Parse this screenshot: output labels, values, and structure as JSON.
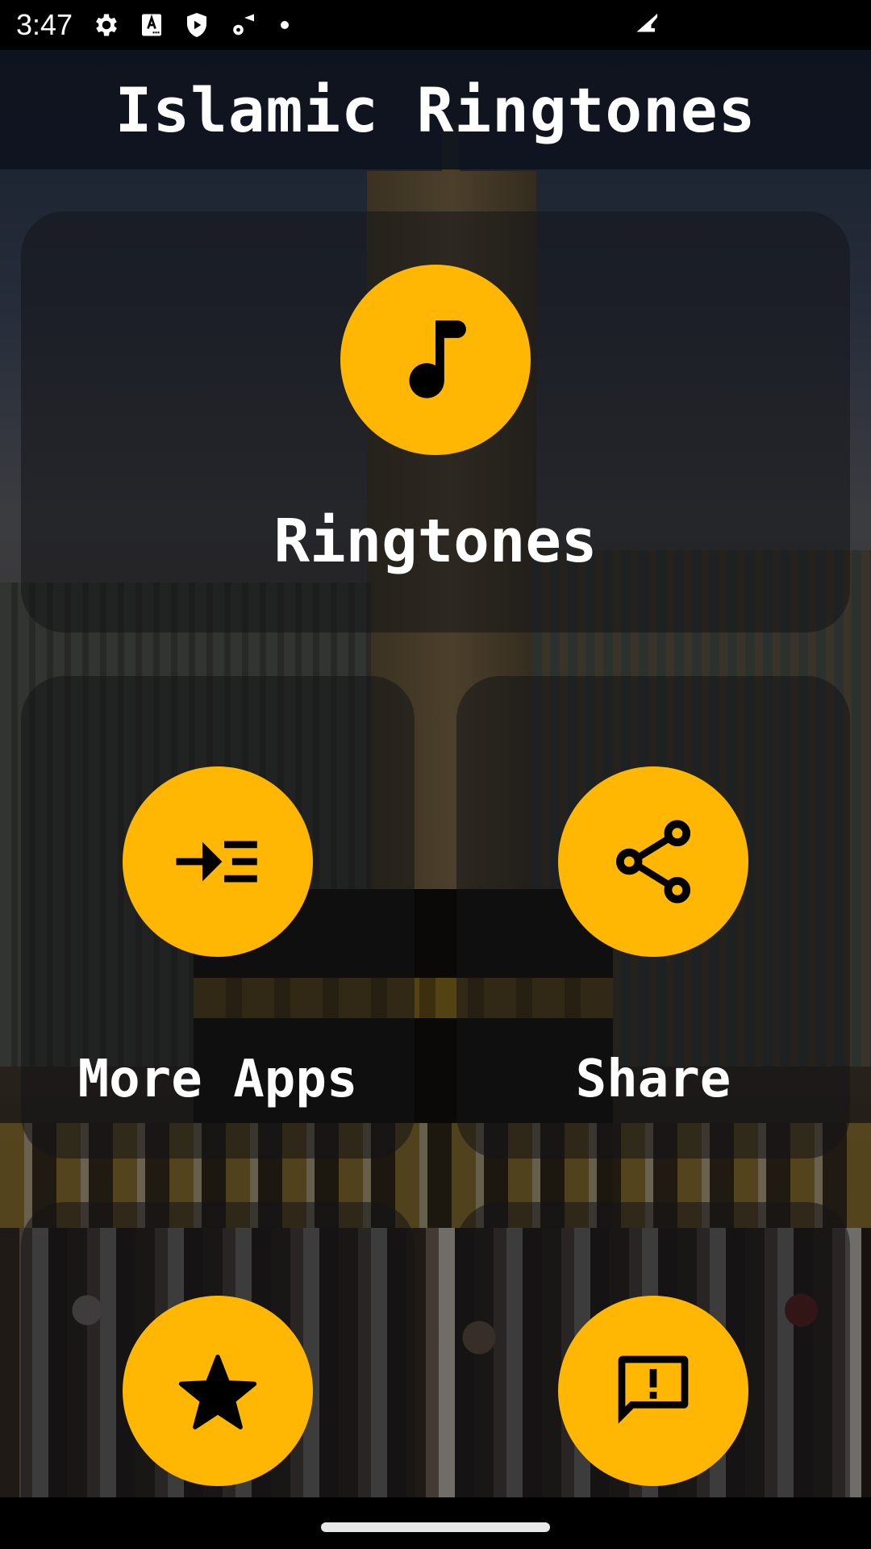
{
  "status_bar": {
    "time": "3:47",
    "icons": [
      "settings-gear-icon",
      "keyboard-a-icon",
      "play-protect-shield-icon",
      "wifi-settings-icon",
      "notification-dot-icon"
    ],
    "right_icons": [
      "cellular-signal-icon"
    ]
  },
  "app": {
    "title": "Islamic Ringtones"
  },
  "colors": {
    "accent": "#FFB703",
    "icon": "#000000",
    "text": "#FFFFFF",
    "title_bar": "#0E141E"
  },
  "cards": [
    {
      "id": "ringtones",
      "label": "Ringtones",
      "icon": "music-note-icon"
    },
    {
      "id": "more_apps",
      "label": "More Apps",
      "icon": "format-indent-increase-icon"
    },
    {
      "id": "share",
      "label": "Share",
      "icon": "share-icon"
    },
    {
      "id": "rate",
      "label": "",
      "icon": "star-icon"
    },
    {
      "id": "feedback",
      "label": "",
      "icon": "feedback-icon"
    }
  ],
  "nav_bar": {
    "home_indicator": "home-gesture-pill"
  }
}
